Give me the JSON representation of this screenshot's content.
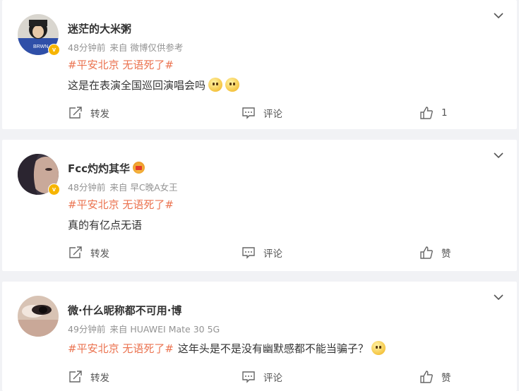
{
  "colors": {
    "topic": "#eb7350",
    "text": "#333333",
    "meta": "#939393",
    "background": "#f1f2f5"
  },
  "comments": [
    {
      "username": "迷茫的大米粥",
      "time": "48分钟前",
      "source": "来自 微博仅供参考",
      "topic": "#平安北京 无语死了#",
      "text": "这是在表演全国巡回演唱会吗",
      "emojis": [
        "dizzy-emoji",
        "dizzy-emoji"
      ],
      "actions": {
        "repost": "转发",
        "comment": "评论",
        "like": "1"
      }
    },
    {
      "username": "Fcc灼灼其华",
      "time": "48分钟前",
      "source": "来自 早C晚A女王",
      "topic": "#平安北京 无语死了#",
      "text": "真的有亿点无语",
      "actions": {
        "repost": "转发",
        "comment": "评论",
        "like": "赞"
      }
    },
    {
      "username": "微·什么昵称都不可用·博",
      "time": "49分钟前",
      "source": "来自 HUAWEI Mate 30 5G",
      "topic": "#平安北京 无语死了#",
      "text": "这年头是不是没有幽默感都不能当骗子？",
      "emojis": [
        "thinking-emoji"
      ],
      "actions": {
        "repost": "转发",
        "comment": "评论",
        "like": "赞"
      }
    }
  ]
}
